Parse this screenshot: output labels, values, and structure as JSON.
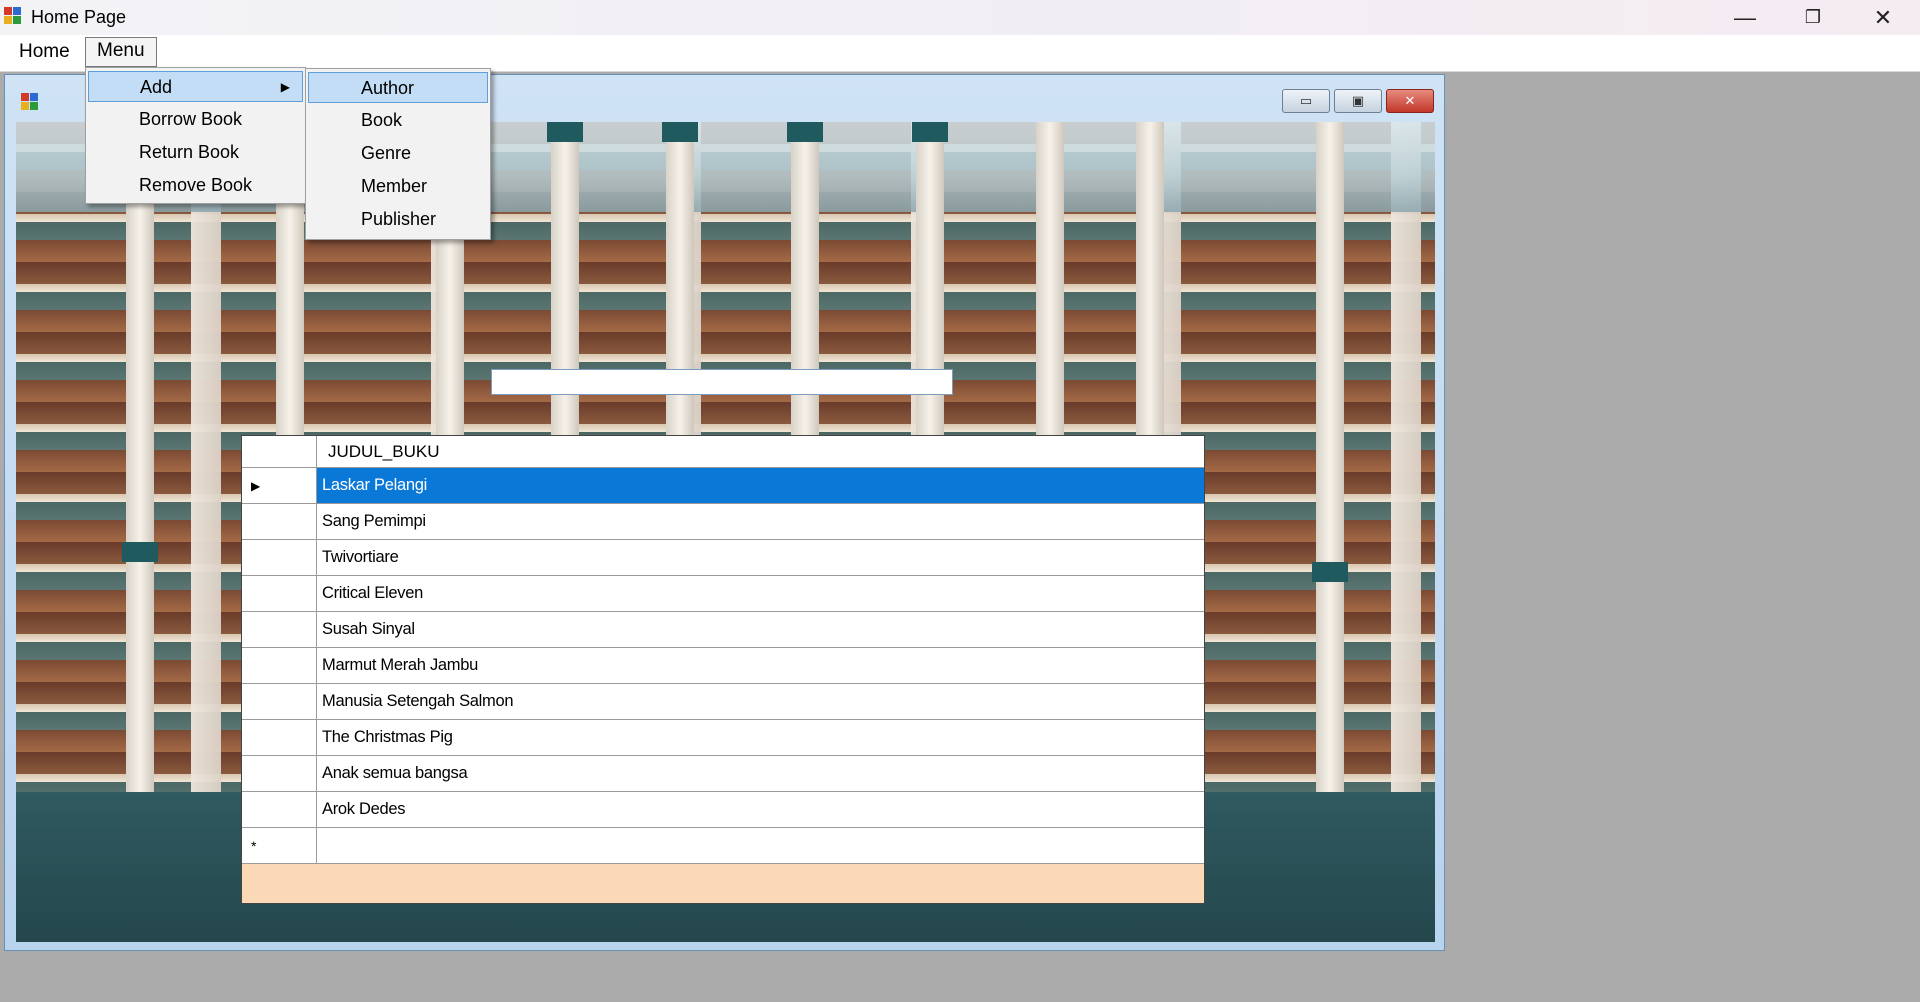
{
  "window": {
    "title": "Home Page",
    "minimize_glyph": "—",
    "restore_glyph": "❐",
    "close_glyph": "✕"
  },
  "menubar": {
    "items": [
      {
        "label": "Home"
      },
      {
        "label": "Menu"
      }
    ]
  },
  "menu_dropdown": {
    "items": [
      {
        "label": "Add",
        "submenu_arrow": "▶"
      },
      {
        "label": "Borrow Book"
      },
      {
        "label": "Return Book"
      },
      {
        "label": "Remove Book"
      }
    ]
  },
  "add_submenu": {
    "items": [
      {
        "label": "Author"
      },
      {
        "label": "Book"
      },
      {
        "label": "Genre"
      },
      {
        "label": "Member"
      },
      {
        "label": "Publisher"
      }
    ]
  },
  "search": {
    "value": ""
  },
  "grid": {
    "column_header": "JUDUL_BUKU",
    "current_row_marker": "▶",
    "new_row_marker": "*",
    "rows": [
      "Laskar Pelangi",
      "Sang Pemimpi",
      "Twivortiare",
      "Critical Eleven",
      "Susah Sinyal",
      "Marmut Merah Jambu",
      "Manusia Setengah Salmon",
      "The Christmas Pig",
      "Anak semua bangsa",
      "Arok Dedes"
    ],
    "new_row_value": ""
  },
  "child_window": {
    "minimize_glyph": "▭",
    "maximize_glyph": "▣",
    "close_glyph": "✕"
  }
}
